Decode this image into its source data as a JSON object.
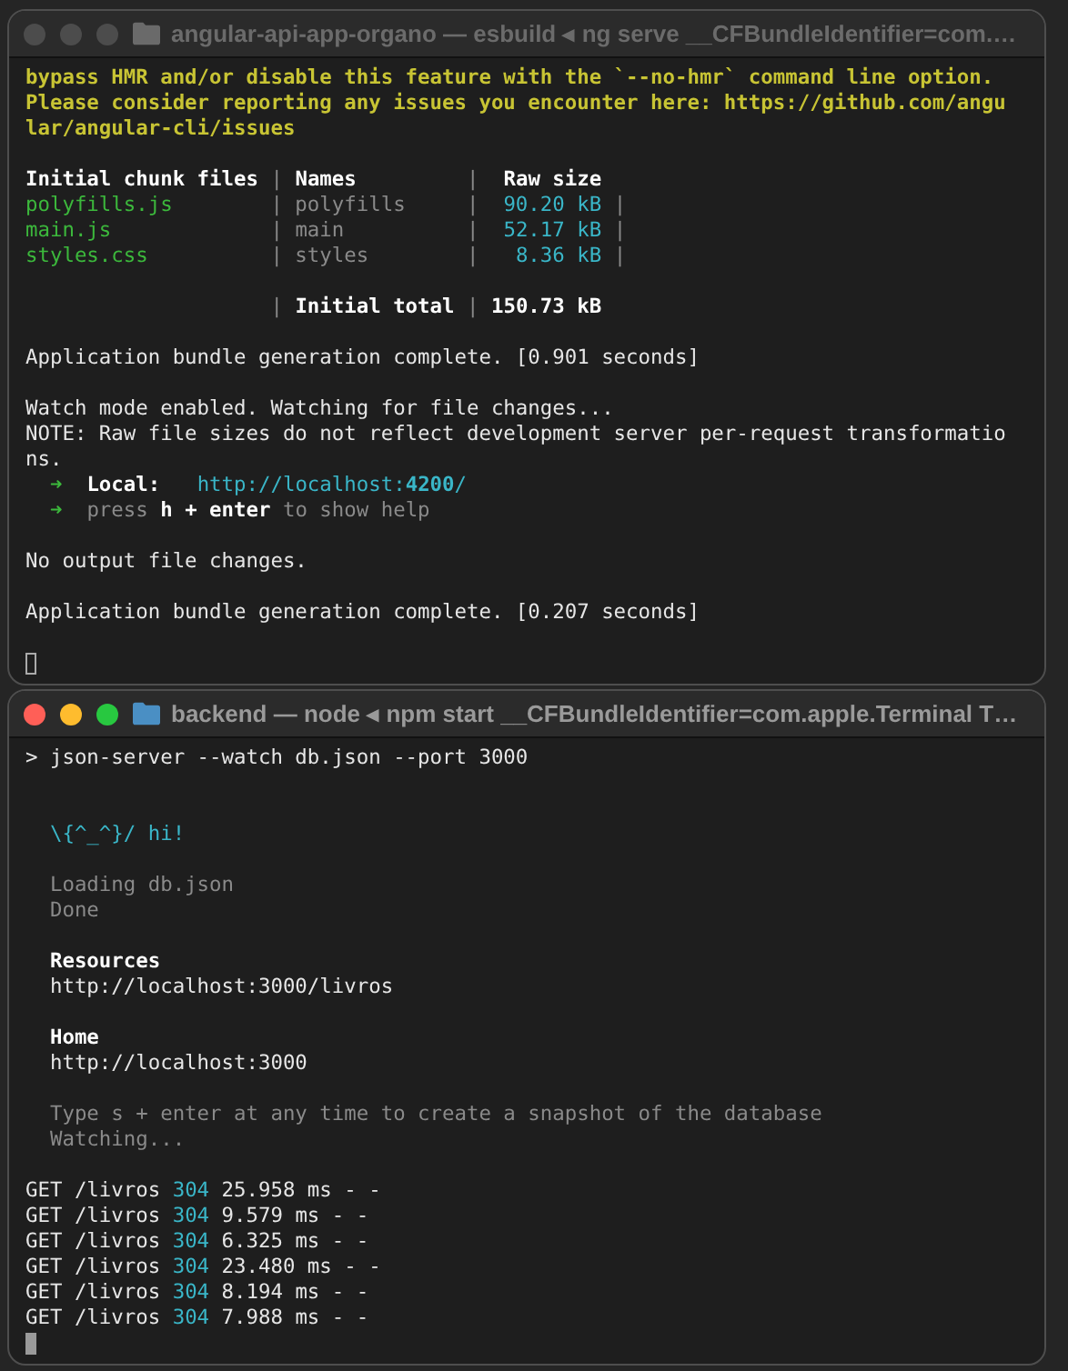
{
  "windows": [
    {
      "title": "angular-api-app-organo — esbuild ◂ ng serve __CFBundleIdentifier=com.…",
      "active": false,
      "lines": [
        {
          "kind": "text",
          "segs": [
            {
              "text": "bypass HMR and/or disable this feature with the `--no-hmr` command line option.",
              "kind": "warn"
            }
          ]
        },
        {
          "kind": "text",
          "segs": [
            {
              "text": "Please consider reporting any issues you encounter here: https://github.com/angu",
              "kind": "warn"
            }
          ]
        },
        {
          "kind": "text",
          "segs": [
            {
              "text": "lar/angular-cli/issues",
              "kind": "warn"
            }
          ]
        },
        {
          "kind": "blank"
        },
        {
          "kind": "text",
          "segs": [
            {
              "text": "Initial chunk files",
              "kind": "bold"
            },
            {
              "text": " | ",
              "kind": "dim"
            },
            {
              "text": "Names",
              "kind": "bold"
            },
            {
              "text": "         |  ",
              "kind": "dim"
            },
            {
              "text": "Raw size",
              "kind": "bold"
            }
          ]
        },
        {
          "kind": "text",
          "segs": [
            {
              "text": "polyfills.js",
              "kind": "file"
            },
            {
              "text": "        | polyfills     |  ",
              "kind": "dim"
            },
            {
              "text": "90.20 kB",
              "kind": "size"
            },
            {
              "text": " |",
              "kind": "dim"
            }
          ]
        },
        {
          "kind": "text",
          "segs": [
            {
              "text": "main.js",
              "kind": "file"
            },
            {
              "text": "             | main          |  ",
              "kind": "dim"
            },
            {
              "text": "52.17 kB",
              "kind": "size"
            },
            {
              "text": " |",
              "kind": "dim"
            }
          ]
        },
        {
          "kind": "text",
          "segs": [
            {
              "text": "styles.css",
              "kind": "file"
            },
            {
              "text": "          | styles        |   ",
              "kind": "dim"
            },
            {
              "text": "8.36 kB",
              "kind": "size"
            },
            {
              "text": " |",
              "kind": "dim"
            }
          ]
        },
        {
          "kind": "blank"
        },
        {
          "kind": "text",
          "segs": [
            {
              "text": "                    | ",
              "kind": "dim"
            },
            {
              "text": "Initial total",
              "kind": "bold"
            },
            {
              "text": " | ",
              "kind": "dim"
            },
            {
              "text": "150.73 kB",
              "kind": "bold"
            }
          ]
        },
        {
          "kind": "blank"
        },
        {
          "kind": "text",
          "segs": [
            {
              "text": "Application bundle generation complete. [0.901 seconds]",
              "kind": "plain"
            }
          ]
        },
        {
          "kind": "blank"
        },
        {
          "kind": "text",
          "segs": [
            {
              "text": "Watch mode enabled. Watching for file changes...",
              "kind": "plain"
            }
          ]
        },
        {
          "kind": "text",
          "segs": [
            {
              "text": "NOTE: Raw file sizes do not reflect development server per-request transformatio",
              "kind": "plain"
            }
          ]
        },
        {
          "kind": "text",
          "segs": [
            {
              "text": "ns.",
              "kind": "plain"
            }
          ]
        },
        {
          "kind": "text",
          "segs": [
            {
              "text": "  ➜  ",
              "kind": "arrow"
            },
            {
              "text": "Local:",
              "kind": "bold"
            },
            {
              "text": "   http://localhost:",
              "kind": "link"
            },
            {
              "text": "4200",
              "kind": "linkbold"
            },
            {
              "text": "/",
              "kind": "link"
            }
          ]
        },
        {
          "kind": "text",
          "segs": [
            {
              "text": "  ➜  ",
              "kind": "arrow"
            },
            {
              "text": "press ",
              "kind": "dim"
            },
            {
              "text": "h + enter",
              "kind": "bold"
            },
            {
              "text": " to show help",
              "kind": "dim"
            }
          ]
        },
        {
          "kind": "blank"
        },
        {
          "kind": "text",
          "segs": [
            {
              "text": "No output file changes.",
              "kind": "plain"
            }
          ]
        },
        {
          "kind": "blank"
        },
        {
          "kind": "text",
          "segs": [
            {
              "text": "Application bundle generation complete. [0.207 seconds]",
              "kind": "plain"
            }
          ]
        },
        {
          "kind": "blank"
        }
      ]
    },
    {
      "title": "backend — node ◂ npm start __CFBundleIdentifier=com.apple.Terminal T…",
      "active": true,
      "lines": [
        {
          "kind": "text",
          "segs": [
            {
              "text": "> json-server --watch db.json --port 3000",
              "kind": "plain"
            }
          ]
        },
        {
          "kind": "blank"
        },
        {
          "kind": "blank"
        },
        {
          "kind": "text",
          "segs": [
            {
              "text": "  \\{^_^}/ hi!",
              "kind": "size"
            }
          ]
        },
        {
          "kind": "blank"
        },
        {
          "kind": "text",
          "segs": [
            {
              "text": "  Loading db.json",
              "kind": "dim"
            }
          ]
        },
        {
          "kind": "text",
          "segs": [
            {
              "text": "  Done",
              "kind": "dim"
            }
          ]
        },
        {
          "kind": "blank"
        },
        {
          "kind": "text",
          "segs": [
            {
              "text": "  Resources",
              "kind": "bold"
            }
          ]
        },
        {
          "kind": "text",
          "segs": [
            {
              "text": "  http://localhost:3000/livros",
              "kind": "plain"
            }
          ]
        },
        {
          "kind": "blank"
        },
        {
          "kind": "text",
          "segs": [
            {
              "text": "  Home",
              "kind": "bold"
            }
          ]
        },
        {
          "kind": "text",
          "segs": [
            {
              "text": "  http://localhost:3000",
              "kind": "plain"
            }
          ]
        },
        {
          "kind": "blank"
        },
        {
          "kind": "text",
          "segs": [
            {
              "text": "  Type s + enter at any time to create a snapshot of the database",
              "kind": "dim"
            }
          ]
        },
        {
          "kind": "text",
          "segs": [
            {
              "text": "  Watching...",
              "kind": "dim"
            }
          ]
        },
        {
          "kind": "blank"
        },
        {
          "kind": "text",
          "segs": [
            {
              "text": "GET /livros ",
              "kind": "plain"
            },
            {
              "text": "304",
              "kind": "size"
            },
            {
              "text": " 25.958 ms - -",
              "kind": "plain"
            }
          ]
        },
        {
          "kind": "text",
          "segs": [
            {
              "text": "GET /livros ",
              "kind": "plain"
            },
            {
              "text": "304",
              "kind": "size"
            },
            {
              "text": " 9.579 ms - -",
              "kind": "plain"
            }
          ]
        },
        {
          "kind": "text",
          "segs": [
            {
              "text": "GET /livros ",
              "kind": "plain"
            },
            {
              "text": "304",
              "kind": "size"
            },
            {
              "text": " 6.325 ms - -",
              "kind": "plain"
            }
          ]
        },
        {
          "kind": "text",
          "segs": [
            {
              "text": "GET /livros ",
              "kind": "plain"
            },
            {
              "text": "304",
              "kind": "size"
            },
            {
              "text": " 23.480 ms - -",
              "kind": "plain"
            }
          ]
        },
        {
          "kind": "text",
          "segs": [
            {
              "text": "GET /livros ",
              "kind": "plain"
            },
            {
              "text": "304",
              "kind": "size"
            },
            {
              "text": " 8.194 ms - -",
              "kind": "plain"
            }
          ]
        },
        {
          "kind": "text",
          "segs": [
            {
              "text": "GET /livros ",
              "kind": "plain"
            },
            {
              "text": "304",
              "kind": "size"
            },
            {
              "text": " 7.988 ms - -",
              "kind": "plain"
            }
          ]
        }
      ]
    }
  ]
}
